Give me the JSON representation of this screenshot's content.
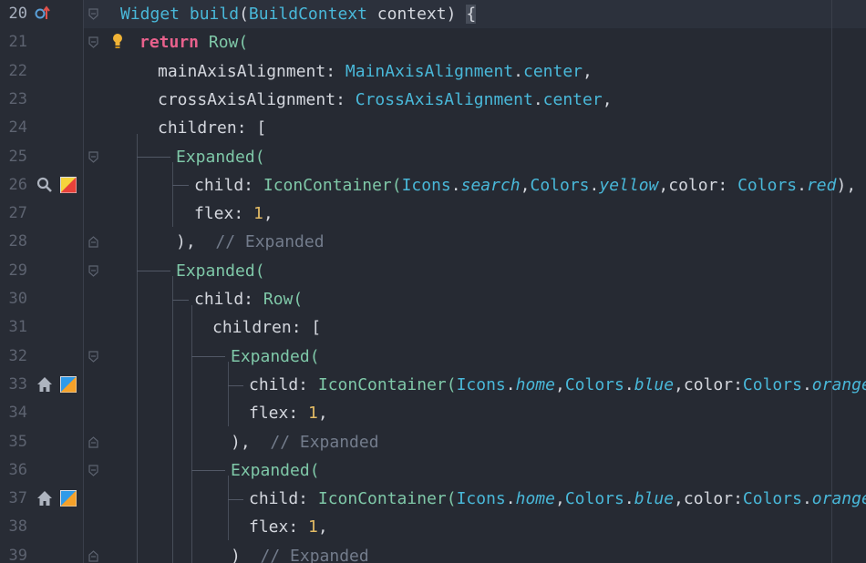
{
  "editor": {
    "lines": [
      {
        "n": "20",
        "parts": [
          [
            "cls",
            "Widget"
          ],
          [
            "plain",
            " "
          ],
          [
            "cls",
            "build"
          ],
          [
            "plain",
            "("
          ],
          [
            "cls",
            "BuildContext"
          ],
          [
            "plain",
            " context) "
          ],
          [
            "brace",
            "{"
          ]
        ]
      },
      {
        "n": "21",
        "parts": [
          [
            "kw",
            "return"
          ],
          [
            "plain",
            " "
          ],
          [
            "exp",
            "Row("
          ]
        ]
      },
      {
        "n": "22",
        "parts": [
          [
            "plain",
            "mainAxisAlignment: "
          ],
          [
            "cls",
            "MainAxisAlignment"
          ],
          [
            "plain",
            "."
          ],
          [
            "mem",
            "center"
          ],
          [
            "plain",
            ","
          ]
        ]
      },
      {
        "n": "23",
        "parts": [
          [
            "plain",
            "crossAxisAlignment: "
          ],
          [
            "cls",
            "CrossAxisAlignment"
          ],
          [
            "plain",
            "."
          ],
          [
            "mem",
            "center"
          ],
          [
            "plain",
            ","
          ]
        ]
      },
      {
        "n": "24",
        "parts": [
          [
            "plain",
            "children: ["
          ]
        ]
      },
      {
        "n": "25",
        "parts": [
          [
            "exp",
            "Expanded("
          ]
        ]
      },
      {
        "n": "26",
        "parts": [
          [
            "plain",
            "child: "
          ],
          [
            "exp",
            "IconContainer("
          ],
          [
            "cls",
            "Icons"
          ],
          [
            "plain",
            "."
          ],
          [
            "prop",
            "search"
          ],
          [
            "plain",
            ","
          ],
          [
            "cls",
            "Colors"
          ],
          [
            "plain",
            "."
          ],
          [
            "prop",
            "yellow"
          ],
          [
            "plain",
            ",color: "
          ],
          [
            "cls",
            "Colors"
          ],
          [
            "plain",
            "."
          ],
          [
            "prop",
            "red"
          ],
          [
            "plain",
            "),"
          ]
        ]
      },
      {
        "n": "27",
        "parts": [
          [
            "plain",
            "flex: "
          ],
          [
            "num",
            "1"
          ],
          [
            "plain",
            ","
          ]
        ]
      },
      {
        "n": "28",
        "parts": [
          [
            "plain",
            "),  "
          ],
          [
            "cm",
            "// Expanded"
          ]
        ]
      },
      {
        "n": "29",
        "parts": [
          [
            "exp",
            "Expanded("
          ]
        ]
      },
      {
        "n": "30",
        "parts": [
          [
            "plain",
            "child: "
          ],
          [
            "exp",
            "Row("
          ]
        ]
      },
      {
        "n": "31",
        "parts": [
          [
            "plain",
            "children: ["
          ]
        ]
      },
      {
        "n": "32",
        "parts": [
          [
            "exp",
            "Expanded("
          ]
        ]
      },
      {
        "n": "33",
        "parts": [
          [
            "plain",
            "child: "
          ],
          [
            "exp",
            "IconContainer("
          ],
          [
            "cls",
            "Icons"
          ],
          [
            "plain",
            "."
          ],
          [
            "prop",
            "home"
          ],
          [
            "plain",
            ","
          ],
          [
            "cls",
            "Colors"
          ],
          [
            "plain",
            "."
          ],
          [
            "prop",
            "blue"
          ],
          [
            "plain",
            ",color:"
          ],
          [
            "cls",
            "Colors"
          ],
          [
            "plain",
            "."
          ],
          [
            "prop",
            "orange"
          ],
          [
            "plain",
            "),"
          ]
        ]
      },
      {
        "n": "34",
        "parts": [
          [
            "plain",
            "flex: "
          ],
          [
            "num",
            "1"
          ],
          [
            "plain",
            ","
          ]
        ]
      },
      {
        "n": "35",
        "parts": [
          [
            "plain",
            "),  "
          ],
          [
            "cm",
            "// Expanded"
          ]
        ]
      },
      {
        "n": "36",
        "parts": [
          [
            "exp",
            "Expanded("
          ]
        ]
      },
      {
        "n": "37",
        "parts": [
          [
            "plain",
            "child: "
          ],
          [
            "exp",
            "IconContainer("
          ],
          [
            "cls",
            "Icons"
          ],
          [
            "plain",
            "."
          ],
          [
            "prop",
            "home"
          ],
          [
            "plain",
            ","
          ],
          [
            "cls",
            "Colors"
          ],
          [
            "plain",
            "."
          ],
          [
            "prop",
            "blue"
          ],
          [
            "plain",
            ",color:"
          ],
          [
            "cls",
            "Colors"
          ],
          [
            "plain",
            "."
          ],
          [
            "prop",
            "orange"
          ],
          [
            "plain",
            "),"
          ]
        ]
      },
      {
        "n": "38",
        "parts": [
          [
            "plain",
            "flex: "
          ],
          [
            "num",
            "1"
          ],
          [
            "plain",
            ","
          ]
        ]
      },
      {
        "n": "39",
        "parts": [
          [
            "plain",
            ")  "
          ],
          [
            "cm",
            "// Expanded"
          ]
        ]
      }
    ]
  },
  "gutter_icons": {
    "line20": [
      "override-method-icon"
    ],
    "line26": [
      "search-icon",
      "color-swatch-yellow-red-icon"
    ],
    "line33": [
      "home-icon",
      "color-swatch-blue-orange-icon"
    ],
    "line37": [
      "home-icon",
      "color-swatch-blue-orange-icon"
    ],
    "line21": [
      "lightbulb-intention-icon"
    ]
  },
  "colors": {
    "background": "#262a33",
    "keyword": "#e8618c",
    "class": "#49b8d9",
    "number": "#e3bb64",
    "comment": "#737c8c",
    "widget": "#7fc8a8"
  }
}
